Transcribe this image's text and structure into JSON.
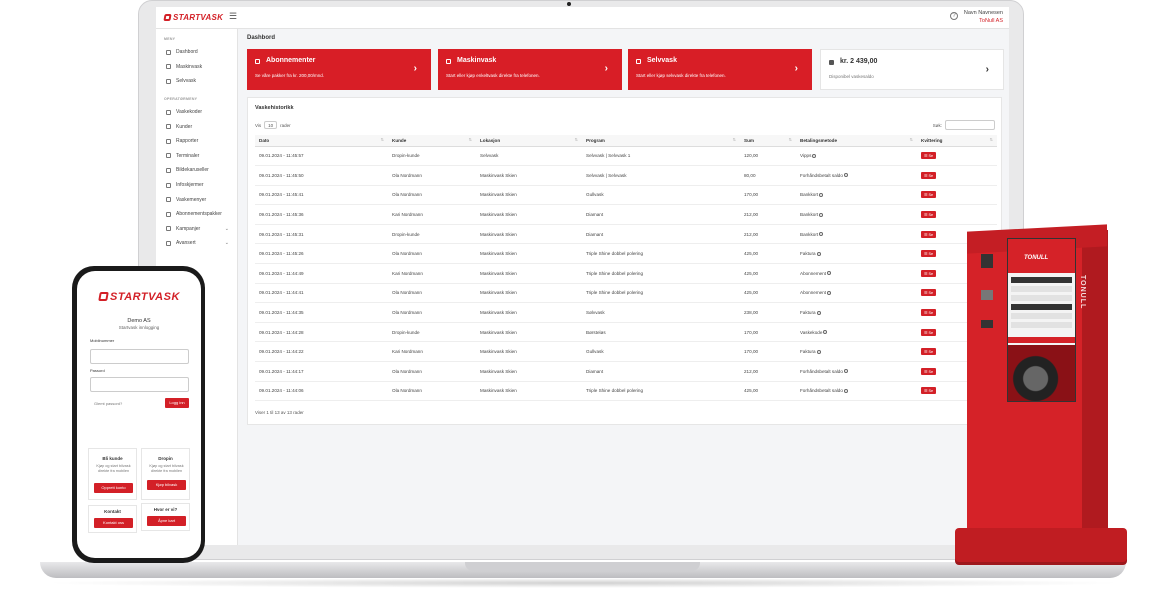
{
  "app": {
    "brand": "STARTVASK",
    "user_name": "Navn Navnesen",
    "user_org": "ToNull AS",
    "page_title": "Dashbord"
  },
  "sidebar": {
    "section_menu": "MENY",
    "section_operations": "OPERATØRMENY",
    "menu_items": [
      {
        "label": "Dashbord",
        "icon": "home-icon"
      },
      {
        "label": "Maskinvask",
        "icon": "car-wash-icon"
      },
      {
        "label": "Selvvask",
        "icon": "spray-icon"
      }
    ],
    "operator_items": [
      {
        "label": "Vaskekoder",
        "icon": "code-icon"
      },
      {
        "label": "Kunder",
        "icon": "users-icon"
      },
      {
        "label": "Rapporter",
        "icon": "report-icon"
      },
      {
        "label": "Terminaler",
        "icon": "terminal-icon"
      },
      {
        "label": "Bildekaruseller",
        "icon": "image-carousel-icon"
      },
      {
        "label": "Infoskjermer",
        "icon": "monitor-icon"
      },
      {
        "label": "Vaskemenyer",
        "icon": "menu-icon"
      },
      {
        "label": "Abonnementspakker",
        "icon": "package-icon"
      },
      {
        "label": "Kampanjer",
        "icon": "campaign-icon",
        "expandable": true
      },
      {
        "label": "Avansert",
        "icon": "gear-icon",
        "expandable": true
      }
    ]
  },
  "cards": [
    {
      "title": "Abonnementer",
      "desc": "Se våre pakker fra kr. 200,00/mnd.",
      "icon": "document-icon",
      "style": "red"
    },
    {
      "title": "Maskinvask",
      "desc": "Start eller kjøp enkeltvask direkte fra telefonen.",
      "icon": "car-wash-icon",
      "style": "red"
    },
    {
      "title": "Selvvask",
      "desc": "Start eller kjøp selvvask direkte fra telefonen.",
      "icon": "spray-icon",
      "style": "red"
    },
    {
      "title": "kr. 2 439,00",
      "desc": "Disponibel vaskesaldo",
      "icon": "wallet-icon",
      "style": "white"
    }
  ],
  "history": {
    "title": "Vaskehistorikk",
    "show_label": "Vis",
    "page_length": "10",
    "rows_label": "rader",
    "search_label": "Søk:",
    "columns": [
      "Dato",
      "Kunde",
      "Lokasjon",
      "Program",
      "Sum",
      "Betalingsmetode",
      "Kvittering"
    ],
    "rows": [
      [
        "09.01.2024 - 11:45:57",
        "Dropin-kunde",
        "Selvvask",
        "Selvvask | Selvvask 1",
        "120,00",
        "Vipps"
      ],
      [
        "09.01.2024 - 11:45:50",
        "Ola Nordmann",
        "Maskinvask Skien",
        "Selvvask | Selvvask",
        "80,00",
        "Forhåndsbetalt saldo"
      ],
      [
        "09.01.2024 - 11:45:41",
        "Ola Nordmann",
        "Maskinvask Skien",
        "Gullvask",
        "170,00",
        "Bankkort"
      ],
      [
        "09.01.2024 - 11:45:36",
        "Kari Nordmann",
        "Maskinvask Skien",
        "Diamant",
        "212,00",
        "Bankkort"
      ],
      [
        "09.01.2024 - 11:45:31",
        "Dropin-kunde",
        "Maskinvask Skien",
        "Diamant",
        "212,00",
        "Bankkort"
      ],
      [
        "09.01.2024 - 11:45:26",
        "Ola Nordmann",
        "Maskinvask Skien",
        "Triple Shine dobbel polering",
        "425,00",
        "Faktura"
      ],
      [
        "09.01.2024 - 11:44:49",
        "Kari Nordmann",
        "Maskinvask Skien",
        "Triple Shine dobbel polering",
        "425,00",
        "Abonnement"
      ],
      [
        "09.01.2024 - 11:44:41",
        "Ola Nordmann",
        "Maskinvask Skien",
        "Triple Shine dobbel polering",
        "425,00",
        "Abonnement"
      ],
      [
        "09.01.2024 - 11:44:35",
        "Ola Nordmann",
        "Maskinvask Skien",
        "Sølvvask",
        "238,00",
        "Faktura"
      ],
      [
        "09.01.2024 - 11:44:28",
        "Dropin-kunde",
        "Maskinvask Skien",
        "Børsteløs",
        "170,00",
        "Vaskekode"
      ],
      [
        "09.01.2024 - 11:44:22",
        "Kari Nordmann",
        "Maskinvask Skien",
        "Gullvask",
        "170,00",
        "Faktura"
      ],
      [
        "09.01.2024 - 11:44:17",
        "Ola Nordmann",
        "Maskinvask Skien",
        "Diamant",
        "212,00",
        "Forhåndsbetalt saldo"
      ],
      [
        "09.01.2024 - 11:44:06",
        "Ola Nordmann",
        "Maskinvask Skien",
        "Triple Shine dobbel polering",
        "425,00",
        "Forhåndsbetalt saldo"
      ]
    ],
    "receipt_button": "Se",
    "footer": "Viser 1 til 13 av 13 rader",
    "prev_label": "Forrige"
  },
  "phone": {
    "brand": "STARTVASK",
    "org": "Demo AS",
    "subtitle": "Startvask innlogging",
    "mobile_label": "Mobilnummer",
    "password_label": "Passord",
    "forgot": "Glemt passord?",
    "login": "Logg inn",
    "boxes": [
      {
        "title": "Bli kunde",
        "desc": "Kjøp og start bilvask direkte fra mobilen",
        "button": "Opprett konto"
      },
      {
        "title": "Dropin",
        "desc": "Kjøp og start bilvask direkte fra mobilen",
        "button": "Kjøp bilvask"
      },
      {
        "title": "Kontakt",
        "desc": "",
        "button": "Kontakt oss"
      },
      {
        "title": "Hvor er vi?",
        "desc": "",
        "button": "Åpne kart"
      }
    ]
  },
  "kiosk": {
    "brand": "TONULL"
  },
  "colors": {
    "brand_red": "#d32027",
    "kiosk_red": "#d52228"
  }
}
